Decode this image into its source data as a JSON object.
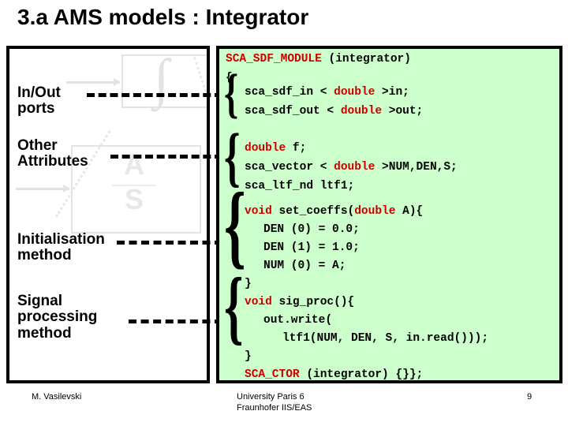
{
  "slide": {
    "title": "3.a  AMS models : Integrator",
    "accent_red": "#cc0000",
    "code_background": "#ccffcc"
  },
  "left_panel": {
    "labels": [
      {
        "id": "in-out-ports",
        "text": "In/Out\nports"
      },
      {
        "id": "other-attributes",
        "text": "Other\nAttributes"
      },
      {
        "id": "initialisation",
        "text": "Initialisation\nmethod"
      },
      {
        "id": "signal-processing",
        "text": "Signal\nprocessing\nmethod"
      }
    ],
    "watermark": {
      "integral_glyph": "∫",
      "block_label_top": "A",
      "block_label_bottom": "S"
    }
  },
  "code_panel": {
    "lines": [
      {
        "id": "module-decl",
        "indent": 0,
        "parts": [
          {
            "t": "SCA_SDF_MODULE",
            "kw": true
          },
          {
            "t": " (integrator)",
            "kw": false
          }
        ]
      },
      {
        "id": "open-brace",
        "indent": 0,
        "parts": [
          {
            "t": "{",
            "kw": false
          }
        ]
      },
      {
        "id": "port-in",
        "indent": 1,
        "parts": [
          {
            "t": "sca_sdf_in < ",
            "kw": false
          },
          {
            "t": "double",
            "kw": true
          },
          {
            "t": " >in;",
            "kw": false
          }
        ]
      },
      {
        "id": "port-out",
        "indent": 1,
        "parts": [
          {
            "t": "sca_sdf_out < ",
            "kw": false
          },
          {
            "t": "double",
            "kw": true
          },
          {
            "t": " >out;",
            "kw": false
          }
        ]
      },
      {
        "id": "attr-f",
        "indent": 1,
        "parts": [
          {
            "t": "double",
            "kw": true
          },
          {
            "t": " f;",
            "kw": false
          }
        ]
      },
      {
        "id": "attr-vectors",
        "indent": 1,
        "parts": [
          {
            "t": "sca_vector < ",
            "kw": false
          },
          {
            "t": "double",
            "kw": true
          },
          {
            "t": " >NUM,DEN,S;",
            "kw": false
          }
        ]
      },
      {
        "id": "attr-ltf",
        "indent": 1,
        "parts": [
          {
            "t": "sca_ltf_nd ltf1;",
            "kw": false
          }
        ]
      },
      {
        "id": "set-coeffs",
        "indent": 1,
        "parts": [
          {
            "t": "void",
            "kw": true
          },
          {
            "t": " set_coeffs(",
            "kw": false
          },
          {
            "t": "double",
            "kw": true
          },
          {
            "t": " A){",
            "kw": false
          }
        ]
      },
      {
        "id": "den-0",
        "indent": 2,
        "parts": [
          {
            "t": "DEN (0) = 0.0;",
            "kw": false
          }
        ]
      },
      {
        "id": "den-1",
        "indent": 2,
        "parts": [
          {
            "t": "DEN (1) = 1.0;",
            "kw": false
          }
        ]
      },
      {
        "id": "num-0",
        "indent": 2,
        "parts": [
          {
            "t": "NUM (0) = A;",
            "kw": false
          }
        ]
      },
      {
        "id": "close-coeffs",
        "indent": 1,
        "parts": [
          {
            "t": "}",
            "kw": false
          }
        ]
      },
      {
        "id": "sig-proc",
        "indent": 1,
        "parts": [
          {
            "t": "void",
            "kw": true
          },
          {
            "t": " sig_proc(){",
            "kw": false
          }
        ]
      },
      {
        "id": "out-write",
        "indent": 2,
        "parts": [
          {
            "t": "out.write(",
            "kw": false
          }
        ]
      },
      {
        "id": "ltf-call",
        "indent": 3,
        "parts": [
          {
            "t": "ltf1(NUM, DEN, S, in.read()));",
            "kw": false
          }
        ]
      },
      {
        "id": "close-proc",
        "indent": 1,
        "parts": [
          {
            "t": "}",
            "kw": false
          }
        ]
      },
      {
        "id": "ctor",
        "indent": 1,
        "parts": [
          {
            "t": "SCA_CTOR",
            "kw": true
          },
          {
            "t": " (integrator) {}};",
            "kw": false
          }
        ]
      }
    ],
    "brace_glyph": "{"
  },
  "footer": {
    "author": "M. Vasilevski",
    "affiliation": "University Paris 6\nFraunhofer IIS/EAS",
    "page_number": "9"
  }
}
